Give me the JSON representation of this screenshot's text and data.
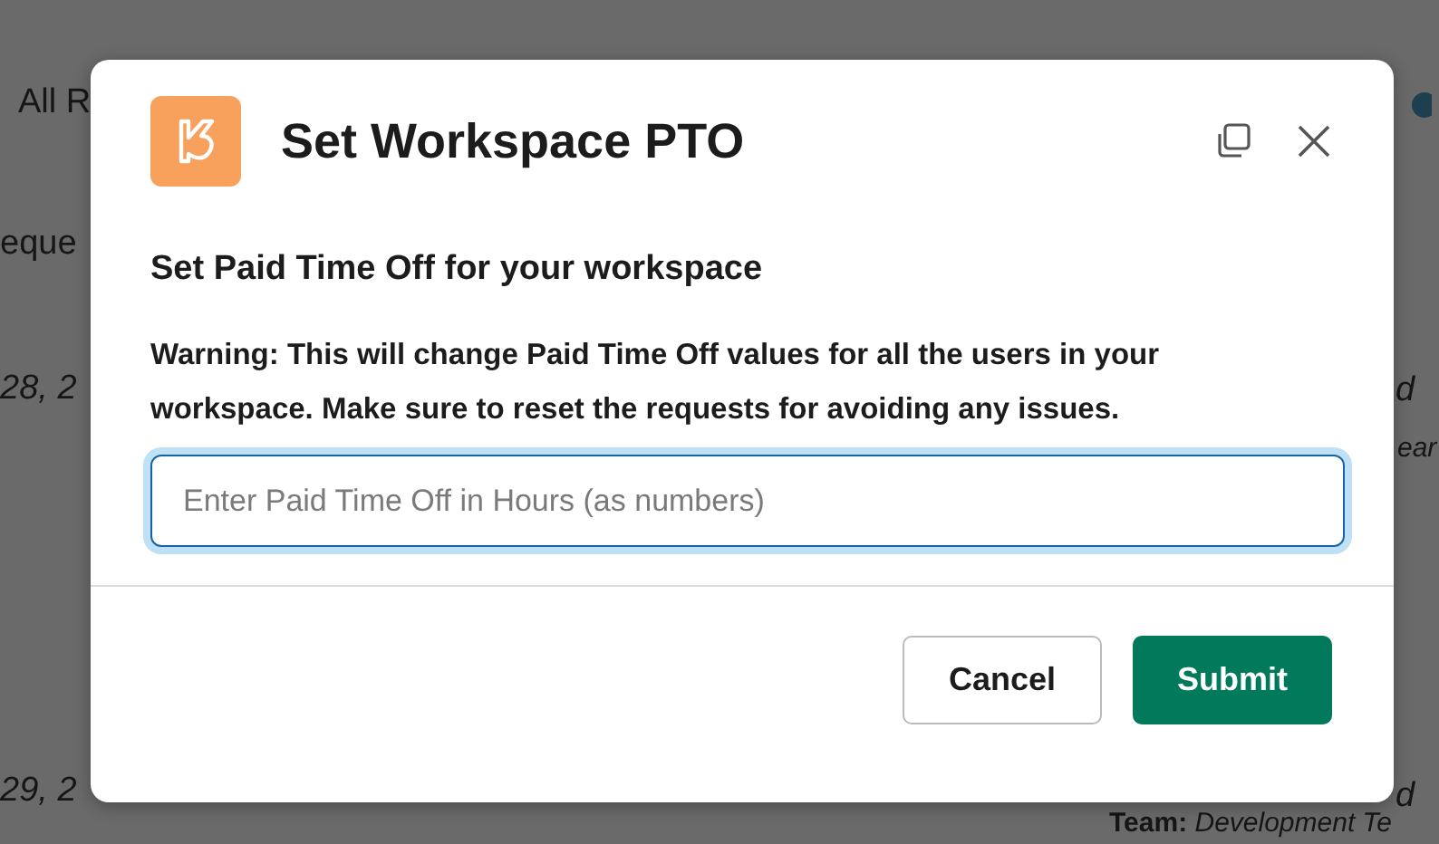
{
  "background": {
    "left_fragments": [
      "All R",
      "eque",
      "28, 2",
      "29, 2"
    ],
    "right_fragments": [
      "d",
      "ear",
      "d"
    ],
    "bottom_fragment": "Team: *Development Te*"
  },
  "dialog": {
    "title": "Set Workspace PTO",
    "heading": "Set Paid Time Off for your workspace",
    "warning": "Warning: This will change Paid Time Off values for all the users in your workspace. Make sure to reset the requests for avoiding any issues.",
    "input": {
      "placeholder": "Enter Paid Time Off in Hours (as numbers)",
      "focused": true
    },
    "buttons": [
      {
        "label": "Cancel",
        "kind": "secondary"
      },
      {
        "label": "Submit",
        "kind": "primary"
      }
    ]
  }
}
